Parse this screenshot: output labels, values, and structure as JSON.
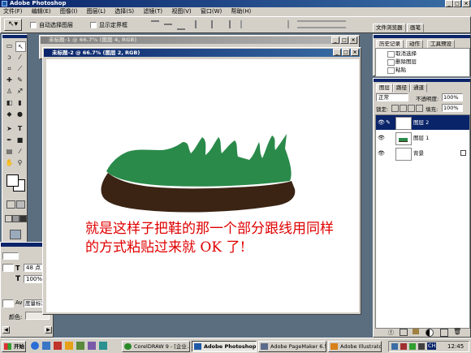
{
  "app": {
    "title": "Adobe Photoshop"
  },
  "menu": [
    "文件(F)",
    "编辑(E)",
    "图像(I)",
    "图层(L)",
    "选择(S)",
    "滤镜(T)",
    "视图(V)",
    "窗口(W)",
    "帮助(H)"
  ],
  "options": {
    "auto_select": "自动选择图层",
    "show_bounds": "显示定界框"
  },
  "palette_well": {
    "file_browser": "文件浏览器",
    "brushes": "画笔"
  },
  "doc1": {
    "title": "未标题-1 @ 66.7% (图层 4, RGB)"
  },
  "doc2": {
    "title": "未标题-2 @ 66.7% (图层 2, RGB)"
  },
  "annotation": {
    "line1": "就是这样子把鞋的那一个部分跟线用同样",
    "line2": "的方式粘贴过来就 OK 了!"
  },
  "history": {
    "tabs": [
      "历史记录",
      "动作",
      "工具预设"
    ],
    "items": [
      "取消选择",
      "删除图层",
      "粘贴"
    ]
  },
  "layers": {
    "tabs": [
      "图层",
      "路径",
      "通道"
    ],
    "blend_mode": "正常",
    "opacity_label": "不透明度:",
    "opacity": "100%",
    "lock_label": "锁定:",
    "fill_label": "填充:",
    "fill": "100%",
    "items": [
      "图层 2",
      "图层 1",
      "背景"
    ]
  },
  "char_panel": {
    "size": "48 点",
    "scale": "100%",
    "aa": "度量标准",
    "color_label": "颜色:"
  },
  "taskbar": {
    "start": "开始",
    "items": [
      "CorelDRAW 9 - [企业...",
      "Adobe Photoshop",
      "Adobe PageMaker 6.5...",
      "Adobe Illustrator"
    ],
    "lang": "CH",
    "clock": "12:45"
  },
  "colors": {
    "shoe_green": "#2a8a4a",
    "shoe_sole": "#3b2414",
    "annotation_red": "#e00000",
    "title_blue": "#0a246a"
  }
}
